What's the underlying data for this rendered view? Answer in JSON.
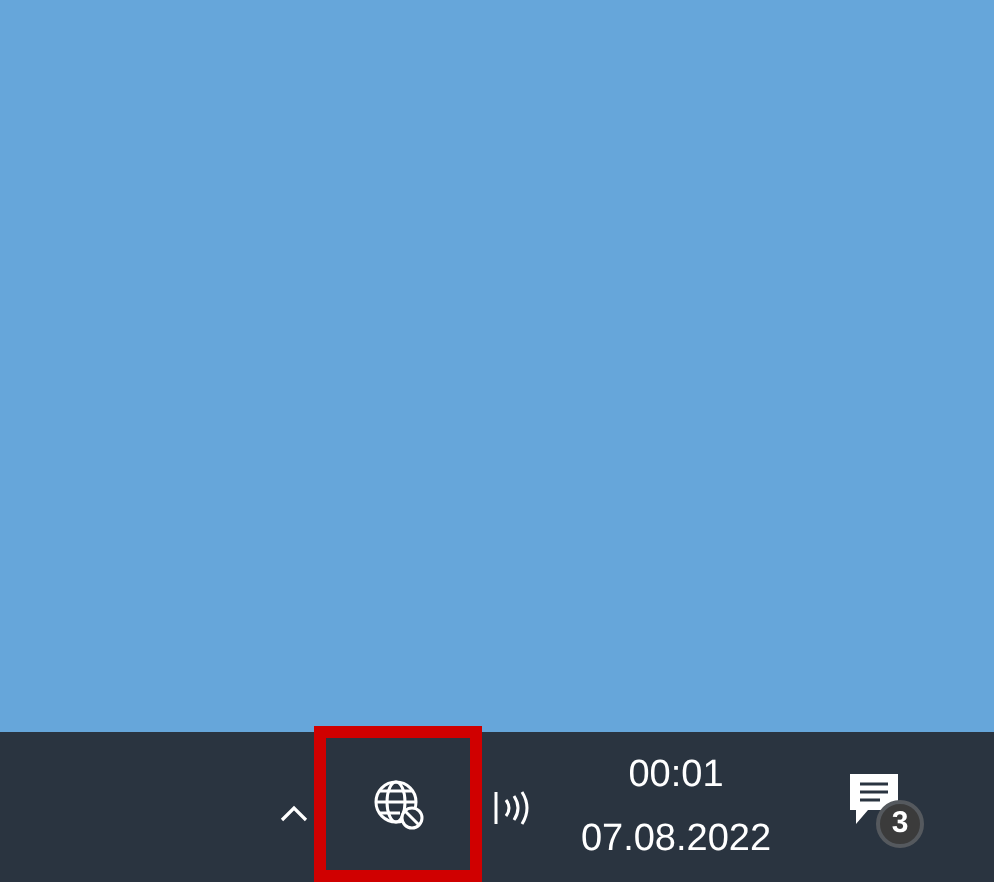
{
  "taskbar": {
    "clock": {
      "time": "00:01",
      "date": "07.08.2022"
    },
    "notifications": {
      "badge": "3"
    }
  }
}
